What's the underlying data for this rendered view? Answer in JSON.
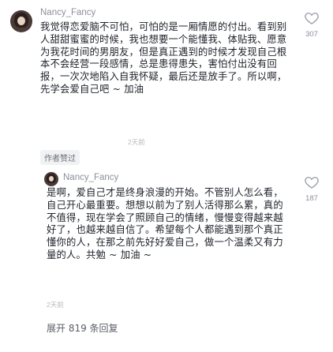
{
  "comment": {
    "username": "Nancy_Fancy",
    "text": "我觉得恋爱脑不可怕，可怕的是一厢情愿的付出。看到别人甜甜蜜蜜的时候，我也想要一个能懂我、体贴我、愿意为我花时间的男朋友，但是真正遇到的时候才发现自己根本不会经营一段感情，总是患得患失，害怕付出没有回报，一次次地陷入自我怀疑，最后还是放手了。所以啊，先学会爱自己吧 ~ 加油",
    "time": "2天前",
    "author_tag": "作者赞过",
    "like_count": "307"
  },
  "reply": {
    "username": "Nancy_Fancy",
    "text": "是啊，爱自己才是终身浪漫的开始。不管别人怎么看，自己开心最重要。想想以前为了别人活得那么累，真的不值得，现在学会了照顾自己的情绪，慢慢变得越来越好了，也越来越自信了。希望每个人都能遇到那个真正懂你的人，在那之前先好好爱自己，做一个温柔又有力量的人。共勉 ~ 加油 ~",
    "time": "2天前",
    "like_count": "187"
  },
  "expand_replies": "展开 819 条回复"
}
